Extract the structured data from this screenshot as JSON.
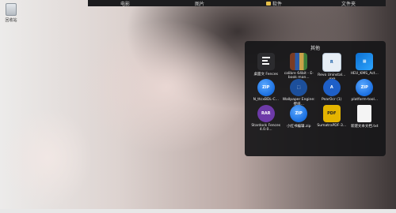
{
  "top_dock": {
    "tabs": [
      "电影",
      "图片",
      "软件",
      "文件夹"
    ]
  },
  "desktop": {
    "icon_label": "回收站"
  },
  "panel": {
    "title": "其他",
    "items": [
      {
        "label": "桌面文 Fences",
        "icon": "fences-icon"
      },
      {
        "label": "calibre 64bit - E-book man...",
        "icon": "calibre-icon"
      },
      {
        "label": "Revo Uninstal... .exe",
        "icon": "revo-uninstaller-icon"
      },
      {
        "label": "HEU_KMS_Act...",
        "icon": "heu-kms-icon"
      },
      {
        "label": "N_ttcxBDL-C...",
        "icon": "zip-icon",
        "glyph": "ZIP"
      },
      {
        "label": "Wallpaper Engine: 壁纸...",
        "icon": "wallpaper-engine-icon"
      },
      {
        "label": "PearOcr (1)",
        "icon": "pear-ocr-icon",
        "glyph": "A"
      },
      {
        "label": "platform-tool...",
        "icon": "zip-icon",
        "glyph": "ZIP"
      },
      {
        "label": "Stardock Fences 4.0.0...",
        "icon": "rar-icon",
        "glyph": "RAR"
      },
      {
        "label": "小红书编辑.zip",
        "icon": "zip-icon",
        "glyph": "ZIP"
      },
      {
        "label": "SumatraPDF-3...",
        "icon": "pdf-icon",
        "glyph": "PDF"
      },
      {
        "label": "新建文本文档.txt",
        "icon": "text-file-icon"
      }
    ]
  }
}
